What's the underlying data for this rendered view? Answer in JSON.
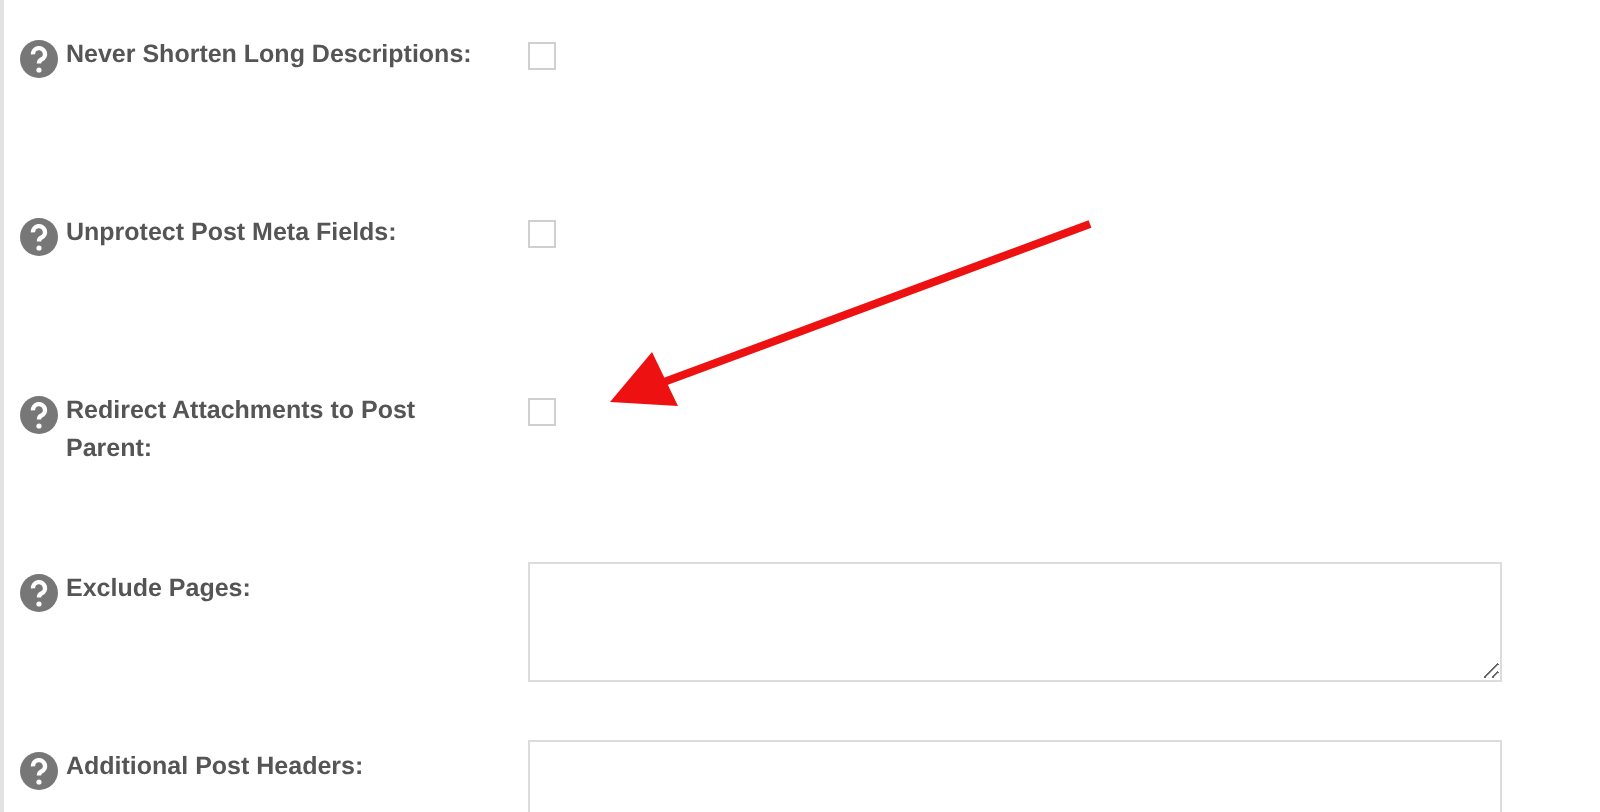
{
  "settings": [
    {
      "kind": "checkbox",
      "label": "Never Shorten Long Descriptions:",
      "checked": false
    },
    {
      "kind": "checkbox",
      "label": "Unprotect Post Meta Fields:",
      "checked": false
    },
    {
      "kind": "checkbox",
      "label": "Redirect Attachments to Post Parent:",
      "checked": false
    },
    {
      "kind": "textarea",
      "label": "Exclude Pages:"
    },
    {
      "kind": "textarea",
      "label": "Additional Post Headers:"
    }
  ]
}
